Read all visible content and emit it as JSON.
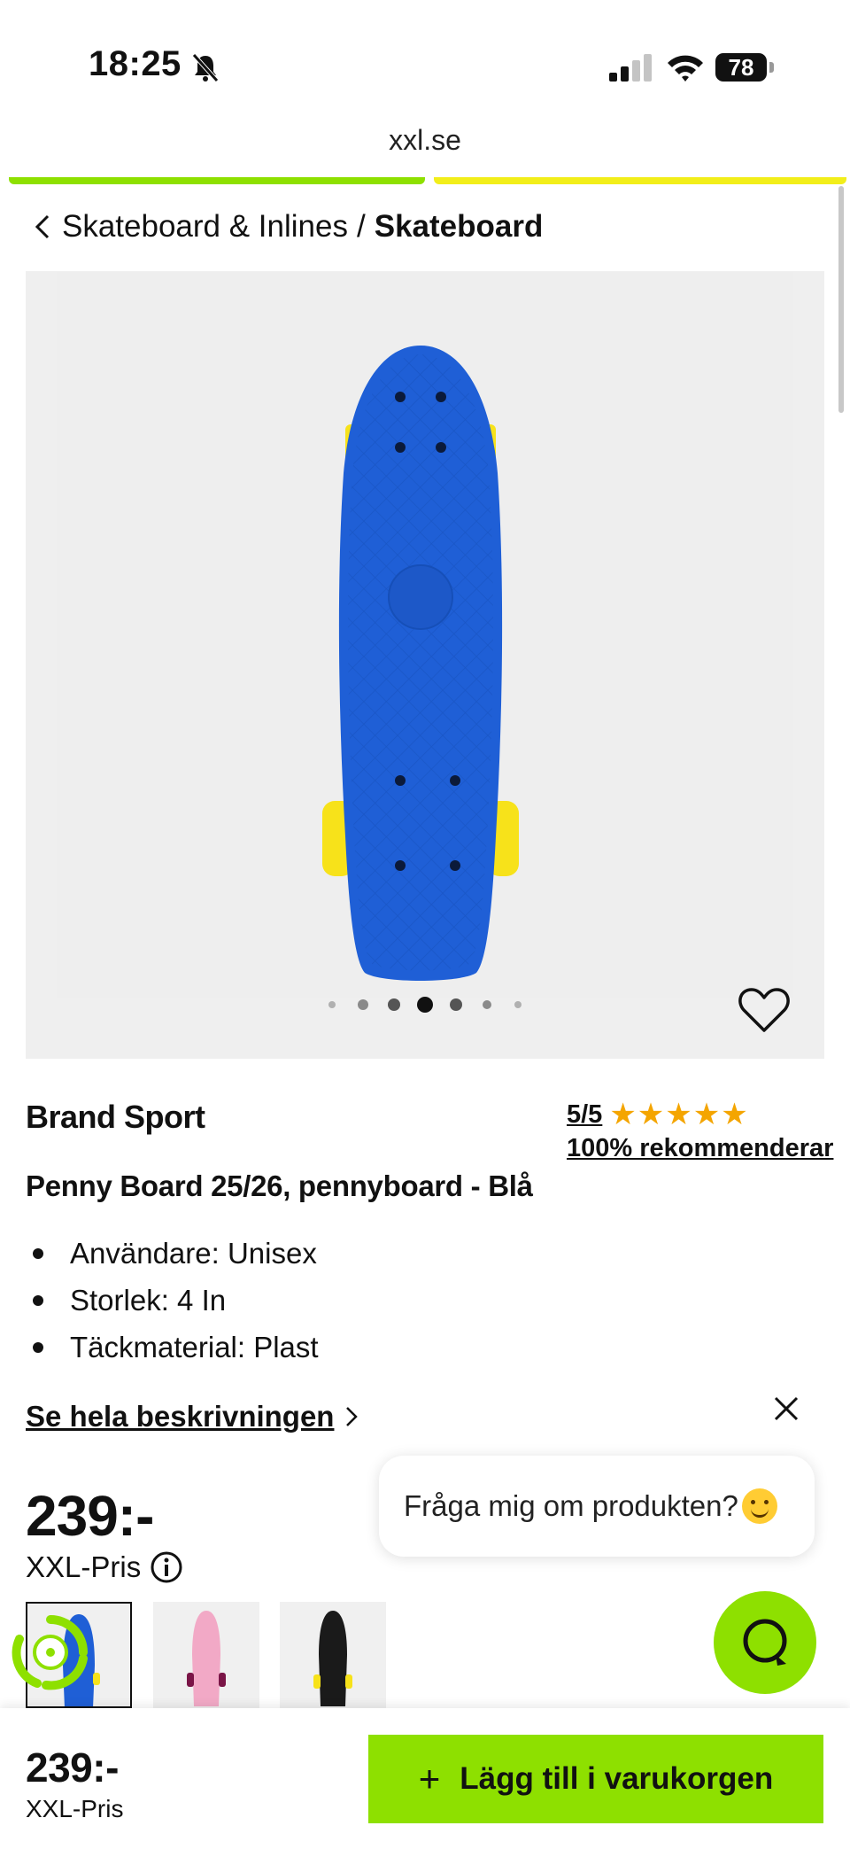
{
  "status_bar": {
    "time": "18:25",
    "battery": "78"
  },
  "browser": {
    "url": "xxl.se"
  },
  "breadcrumb": {
    "parent": "Skateboard & Inlines",
    "separator": "/",
    "current": "Skateboard"
  },
  "gallery": {
    "image_count": 7,
    "active_index": 3
  },
  "product": {
    "brand": "Brand Sport",
    "rating_score": "5/5",
    "rating_stars": 5,
    "rating_stars_glyphs": "★★★★★",
    "recommend": "100% rekommenderar",
    "title": "Penny Board 25/26, pennyboard - Blå",
    "features": [
      "Användare: Unisex",
      "Storlek: 4 In",
      "Täckmaterial: Plast"
    ],
    "description_link": "Se hela beskrivningen",
    "price": "239:-",
    "price_label": "XXL-Pris"
  },
  "chat": {
    "prompt": "Fråga mig om produkten?"
  },
  "bottom_bar": {
    "price": "239:-",
    "price_label": "XXL-Pris",
    "add_to_cart": "Lägg till i varukorgen"
  },
  "colors": {
    "accent_green": "#8ee000",
    "accent_yellow": "#f2ee1a",
    "board_blue": "#1f5fd6",
    "wheel_yellow": "#f7e21a",
    "star": "#f4a500"
  },
  "icons": [
    "bell-muted-icon",
    "signal-icon",
    "wifi-icon",
    "battery-icon",
    "chevron-left-icon",
    "heart-icon",
    "close-icon",
    "info-icon",
    "chevron-right-icon",
    "recycle-icon",
    "chat-icon",
    "plus-icon"
  ]
}
